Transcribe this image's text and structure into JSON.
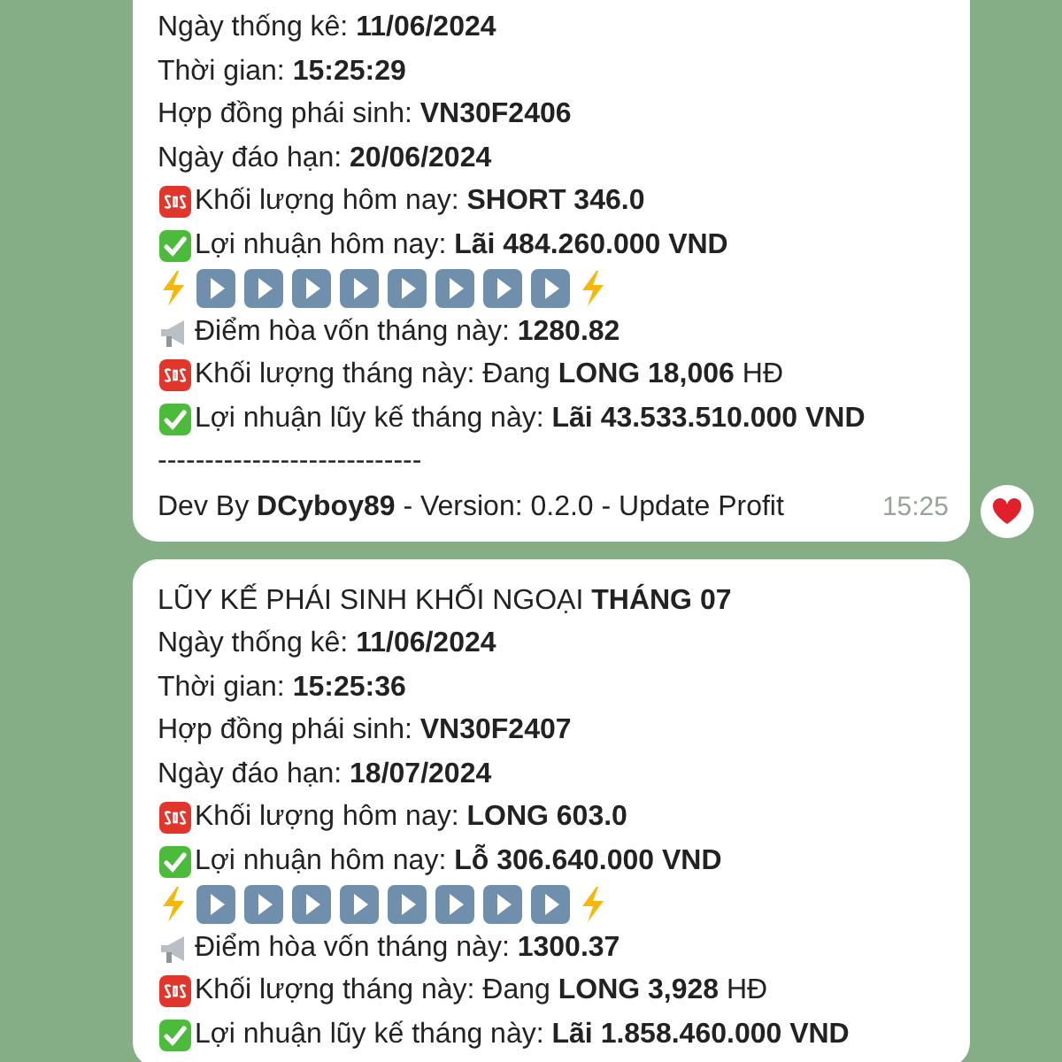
{
  "messages": [
    {
      "lines": [
        {
          "kind": "text",
          "text": "Ngày thống kê: **11/06/2024**"
        },
        {
          "kind": "text",
          "text": "Thời gian: **15:25:29**"
        },
        {
          "kind": "text",
          "text": "Hợp đồng phái sinh: **VN30F2406**"
        },
        {
          "kind": "text",
          "text": "Ngày đáo hạn: **20/06/2024**"
        },
        {
          "kind": "sos",
          "text": "Khối lượng hôm nay: **SHORT 346.0**"
        },
        {
          "kind": "check",
          "text": "Lợi nhuận hôm nay: **Lãi 484.260.000 VND**"
        },
        {
          "kind": "play_row"
        },
        {
          "kind": "megaphone",
          "text": "Điểm hòa vốn tháng này: **1280.82**"
        },
        {
          "kind": "sos",
          "text": "Khối lượng tháng này: Đang **LONG 18,006** HĐ"
        },
        {
          "kind": "check",
          "text": "Lợi nhuận lũy kế tháng này: **Lãi 43.533.510.000 VND**"
        },
        {
          "kind": "text",
          "text": "----------------------------"
        },
        {
          "kind": "footer",
          "text": "Dev By **DCyboy89** - Version: 0.2.0 - Update Profit"
        }
      ],
      "time": "15:25",
      "liked": true
    },
    {
      "lines": [
        {
          "kind": "text",
          "text": "LŨY KẾ PHÁI SINH KHỐI NGOẠI **THÁNG 07**"
        },
        {
          "kind": "text",
          "text": "Ngày thống kê: **11/06/2024**"
        },
        {
          "kind": "text",
          "text": "Thời gian: **15:25:36**"
        },
        {
          "kind": "text",
          "text": "Hợp đồng phái sinh: **VN30F2407**"
        },
        {
          "kind": "text",
          "text": "Ngày đáo hạn: **18/07/2024**"
        },
        {
          "kind": "sos",
          "text": "Khối lượng hôm nay: **LONG 603.0**"
        },
        {
          "kind": "check",
          "text": "Lợi nhuận hôm nay: **Lỗ 306.640.000 VND**"
        },
        {
          "kind": "play_row"
        },
        {
          "kind": "megaphone",
          "text": "Điểm hòa vốn tháng này: **1300.37**"
        },
        {
          "kind": "sos",
          "text": "Khối lượng tháng này: Đang **LONG 3,928** HĐ"
        },
        {
          "kind": "check",
          "text": "Lợi nhuận lũy kế tháng này: **Lãi 1.858.460.000 VND**"
        }
      ]
    }
  ]
}
